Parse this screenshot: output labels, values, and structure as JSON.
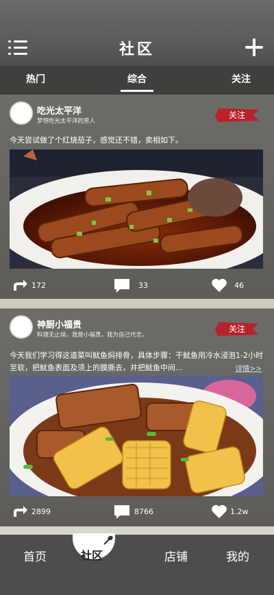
{
  "header": {
    "title": "社区"
  },
  "tabs": [
    {
      "label": "热门",
      "active": false
    },
    {
      "label": "综合",
      "active": true
    },
    {
      "label": "关注",
      "active": false
    }
  ],
  "posts": [
    {
      "username": "吃光太平洋",
      "subtitle": "梦想吃光太平洋的男人",
      "follow_label": "关注",
      "text": "今天尝试做了个红烧茄子，感觉还不错，卖相如下。",
      "more_label": "",
      "shares": "172",
      "comments": "33",
      "likes": "46"
    },
    {
      "username": "神厨小福贵",
      "subtitle": "料理无止境，我是小福贵，我为自己代言。",
      "follow_label": "关注",
      "text": "今天我们学习得这道菜叫鱿鱼焖排骨，具体步骤：干鱿鱼用冷水浸泡1-2小时至软，把鱿鱼表面及须上的膜撕去，并把鱿鱼中间...",
      "more_label": "详情>>",
      "shares": "2899",
      "comments": "8766",
      "likes": "1.2w"
    }
  ],
  "bottom_nav": [
    {
      "label": "首页"
    },
    {
      "label": "社区"
    },
    {
      "label": "店铺"
    },
    {
      "label": "我的"
    }
  ],
  "colors": {
    "follow_red": "#b8222a",
    "header_gray": "#5c5c5a",
    "tab_bar": "#3f3f3d"
  }
}
